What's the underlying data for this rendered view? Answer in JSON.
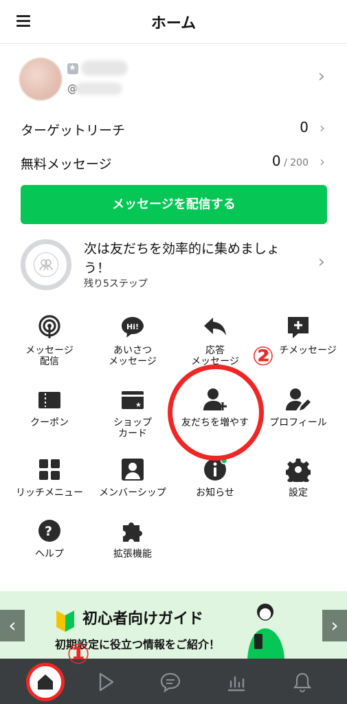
{
  "header": {
    "title": "ホーム"
  },
  "account": {
    "at": "@"
  },
  "stats": [
    {
      "label": "ターゲットリーチ",
      "value": "0",
      "sub": ""
    },
    {
      "label": "無料メッセージ",
      "value": "0",
      "sub": " / 200"
    }
  ],
  "cta_label": "メッセージを配信する",
  "steps": {
    "title": "次は友だちを効率的に集めましょう！",
    "remaining": "残り5ステップ"
  },
  "grid": [
    {
      "label": "メッセージ\n配信",
      "icon": "broadcast-icon"
    },
    {
      "label": "あいさつ\nメッセージ",
      "icon": "hi-bubble-icon"
    },
    {
      "label": "応答\nメッセージ",
      "icon": "reply-arrow-icon"
    },
    {
      "label": "リッチメッセージ",
      "icon": "rich-message-icon"
    },
    {
      "label": "クーポン",
      "icon": "coupon-icon"
    },
    {
      "label": "ショップ\nカード",
      "icon": "shop-card-icon"
    },
    {
      "label": "友だちを増やす",
      "icon": "add-friend-icon"
    },
    {
      "label": "プロフィール",
      "icon": "profile-edit-icon"
    },
    {
      "label": "リッチメニュー",
      "icon": "rich-menu-icon"
    },
    {
      "label": "メンバーシップ",
      "icon": "membership-icon"
    },
    {
      "label": "お知らせ",
      "icon": "info-icon"
    },
    {
      "label": "設定",
      "icon": "gear-icon"
    },
    {
      "label": "ヘルプ",
      "icon": "help-icon"
    },
    {
      "label": "拡張機能",
      "icon": "puzzle-icon"
    }
  ],
  "annotations": {
    "step1": "①",
    "step2": "②"
  },
  "banner": {
    "title": "初心者向けガイド",
    "subtitle": "初期設定に役立つ情報をご紹介！"
  },
  "colors": {
    "brand": "#06c755",
    "annotation": "#f02626",
    "tabbar": "#3b3e40"
  },
  "tabs": [
    "home-icon",
    "play-icon",
    "chat-icon",
    "analytics-icon",
    "bell-icon"
  ]
}
